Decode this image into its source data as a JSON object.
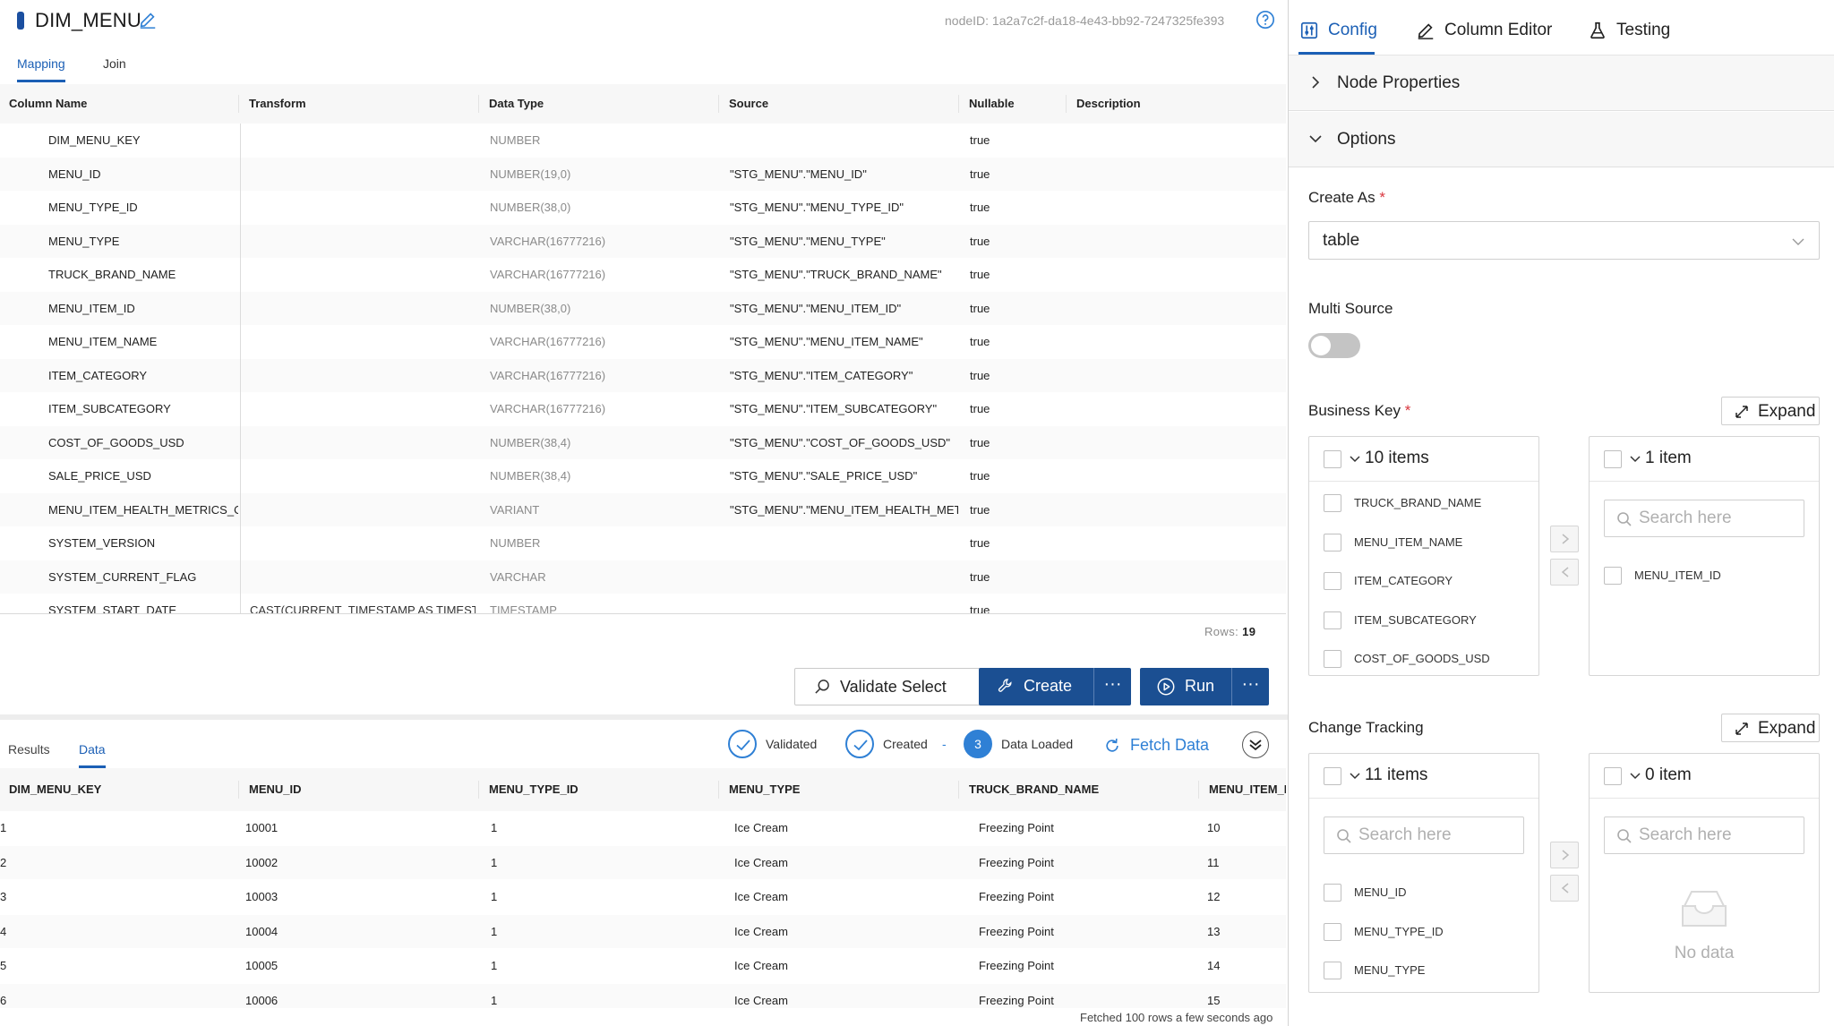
{
  "header": {
    "title": "DIM_MENU",
    "node_id": "nodeID: 1a2a7c2f-da18-4e43-bb92-7247325fe393"
  },
  "top_tabs": [
    {
      "label": "Mapping",
      "active": true
    },
    {
      "label": "Join",
      "active": false
    }
  ],
  "mapping": {
    "headers": [
      "Column Name",
      "Transform",
      "Data Type",
      "Source",
      "Nullable",
      "Description"
    ],
    "rows": [
      {
        "name": "DIM_MENU_KEY",
        "transform": "",
        "dtype": "NUMBER",
        "source": "",
        "nullable": "true"
      },
      {
        "name": "MENU_ID",
        "transform": "",
        "dtype": "NUMBER(19,0)",
        "source": "\"STG_MENU\".\"MENU_ID\"",
        "nullable": "true"
      },
      {
        "name": "MENU_TYPE_ID",
        "transform": "",
        "dtype": "NUMBER(38,0)",
        "source": "\"STG_MENU\".\"MENU_TYPE_ID\"",
        "nullable": "true"
      },
      {
        "name": "MENU_TYPE",
        "transform": "",
        "dtype": "VARCHAR(16777216)",
        "source": "\"STG_MENU\".\"MENU_TYPE\"",
        "nullable": "true"
      },
      {
        "name": "TRUCK_BRAND_NAME",
        "transform": "",
        "dtype": "VARCHAR(16777216)",
        "source": "\"STG_MENU\".\"TRUCK_BRAND_NAME\"",
        "nullable": "true"
      },
      {
        "name": "MENU_ITEM_ID",
        "transform": "",
        "dtype": "NUMBER(38,0)",
        "source": "\"STG_MENU\".\"MENU_ITEM_ID\"",
        "nullable": "true"
      },
      {
        "name": "MENU_ITEM_NAME",
        "transform": "",
        "dtype": "VARCHAR(16777216)",
        "source": "\"STG_MENU\".\"MENU_ITEM_NAME\"",
        "nullable": "true"
      },
      {
        "name": "ITEM_CATEGORY",
        "transform": "",
        "dtype": "VARCHAR(16777216)",
        "source": "\"STG_MENU\".\"ITEM_CATEGORY\"",
        "nullable": "true"
      },
      {
        "name": "ITEM_SUBCATEGORY",
        "transform": "",
        "dtype": "VARCHAR(16777216)",
        "source": "\"STG_MENU\".\"ITEM_SUBCATEGORY\"",
        "nullable": "true"
      },
      {
        "name": "COST_OF_GOODS_USD",
        "transform": "",
        "dtype": "NUMBER(38,4)",
        "source": "\"STG_MENU\".\"COST_OF_GOODS_USD\"",
        "nullable": "true"
      },
      {
        "name": "SALE_PRICE_USD",
        "transform": "",
        "dtype": "NUMBER(38,4)",
        "source": "\"STG_MENU\".\"SALE_PRICE_USD\"",
        "nullable": "true"
      },
      {
        "name": "MENU_ITEM_HEALTH_METRICS_OE",
        "transform": "",
        "dtype": "VARIANT",
        "source": "\"STG_MENU\".\"MENU_ITEM_HEALTH_METR",
        "nullable": "true"
      },
      {
        "name": "SYSTEM_VERSION",
        "transform": "",
        "dtype": "NUMBER",
        "source": "",
        "nullable": "true"
      },
      {
        "name": "SYSTEM_CURRENT_FLAG",
        "transform": "",
        "dtype": "VARCHAR",
        "source": "",
        "nullable": "true"
      },
      {
        "name": "SYSTEM_START_DATE",
        "transform": "CAST(CURRENT_TIMESTAMP AS TIMESTA",
        "dtype": "TIMESTAMP",
        "source": "",
        "nullable": "true"
      }
    ],
    "rows_label": "Rows:",
    "rows_count": "19"
  },
  "actions": {
    "validate_label": "Validate Select",
    "create_label": "Create",
    "run_label": "Run",
    "more_label": "···"
  },
  "bottom_tabs": [
    {
      "label": "Results",
      "active": false
    },
    {
      "label": "Data",
      "active": true
    }
  ],
  "progress": {
    "validated": "Validated",
    "created": "Created",
    "step3_num": "3",
    "data_loaded": "Data Loaded",
    "dash": "-",
    "fetch_label": "Fetch Data"
  },
  "data_table": {
    "headers": [
      "DIM_MENU_KEY",
      "MENU_ID",
      "MENU_TYPE_ID",
      "MENU_TYPE",
      "TRUCK_BRAND_NAME",
      "MENU_ITEM_I"
    ],
    "rows": [
      [
        "1",
        "10001",
        "1",
        "Ice Cream",
        "Freezing Point",
        "10"
      ],
      [
        "2",
        "10002",
        "1",
        "Ice Cream",
        "Freezing Point",
        "11"
      ],
      [
        "3",
        "10003",
        "1",
        "Ice Cream",
        "Freezing Point",
        "12"
      ],
      [
        "4",
        "10004",
        "1",
        "Ice Cream",
        "Freezing Point",
        "13"
      ],
      [
        "5",
        "10005",
        "1",
        "Ice Cream",
        "Freezing Point",
        "14"
      ],
      [
        "6",
        "10006",
        "1",
        "Ice Cream",
        "Freezing Point",
        "15"
      ]
    ],
    "fetched_text": "Fetched 100 rows   a few seconds ago"
  },
  "right_tabs": [
    {
      "label": "Config",
      "icon": "sliders-icon",
      "active": true
    },
    {
      "label": "Column Editor",
      "icon": "pencil-icon",
      "active": false
    },
    {
      "label": "Testing",
      "icon": "flask-icon",
      "active": false
    }
  ],
  "sections": {
    "node_properties": "Node Properties",
    "options": "Options"
  },
  "create_as": {
    "label": "Create As",
    "required_mark": "*",
    "value": "table"
  },
  "multi_source": {
    "label": "Multi Source",
    "enabled": false
  },
  "business_key": {
    "label": "Business Key",
    "required_mark": "*",
    "expand_label": "Expand",
    "left_count": "10 items",
    "left_items": [
      "TRUCK_BRAND_NAME",
      "MENU_ITEM_NAME",
      "ITEM_CATEGORY",
      "ITEM_SUBCATEGORY",
      "COST_OF_GOODS_USD"
    ],
    "right_count": "1 item",
    "right_search_placeholder": "Search here",
    "right_items": [
      "MENU_ITEM_ID"
    ]
  },
  "change_tracking": {
    "label": "Change Tracking",
    "expand_label": "Expand",
    "left_count": "11 items",
    "left_search_placeholder": "Search here",
    "left_items": [
      "MENU_ID",
      "MENU_TYPE_ID",
      "MENU_TYPE"
    ],
    "right_count": "0 item",
    "right_search_placeholder": "Search here",
    "empty_text": "No data"
  },
  "colors": {
    "primary": "#1b4f92",
    "accent": "#1b5fb5",
    "step": "#2f80d5",
    "required": "#d9363e"
  }
}
